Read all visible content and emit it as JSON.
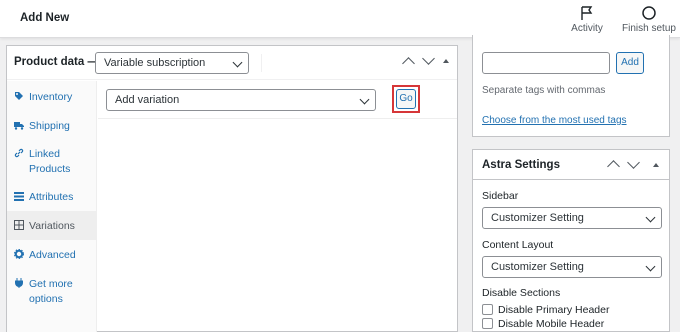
{
  "header": {
    "title": "Add New",
    "actions": [
      {
        "label": "Activity",
        "icon": "flag-icon"
      },
      {
        "label": "Finish setup",
        "icon": "circle-icon"
      }
    ]
  },
  "product_data": {
    "title": "Product data —",
    "type_select": "Variable subscription",
    "tabs": [
      {
        "label": "Inventory",
        "icon": "tag-icon"
      },
      {
        "label": "Shipping",
        "icon": "truck-icon"
      },
      {
        "label": "Linked Products",
        "line1": "Linked",
        "line2": "Products",
        "icon": "link-icon"
      },
      {
        "label": "Attributes",
        "icon": "list-icon"
      },
      {
        "label": "Variations",
        "icon": "grid-icon",
        "active": true
      },
      {
        "label": "Advanced",
        "icon": "gear-icon"
      },
      {
        "label": "Get more options",
        "line1": "Get more",
        "line2": "options",
        "icon": "plugin-icon"
      }
    ],
    "variations": {
      "action_select": "Add variation",
      "go_label": "Go"
    }
  },
  "tags": {
    "add_label": "Add",
    "help": "Separate tags with commas",
    "link": "Choose from the most used tags"
  },
  "astra": {
    "title": "Astra Settings",
    "sidebar_label": "Sidebar",
    "sidebar_value": "Customizer Setting",
    "content_layout_label": "Content Layout",
    "content_layout_value": "Customizer Setting",
    "disable_sections_label": "Disable Sections",
    "checkboxes": [
      "Disable Primary Header",
      "Disable Mobile Header"
    ]
  },
  "colors": {
    "accent": "#2271b1",
    "highlight": "#d63638",
    "background": "#f0f0f1"
  }
}
